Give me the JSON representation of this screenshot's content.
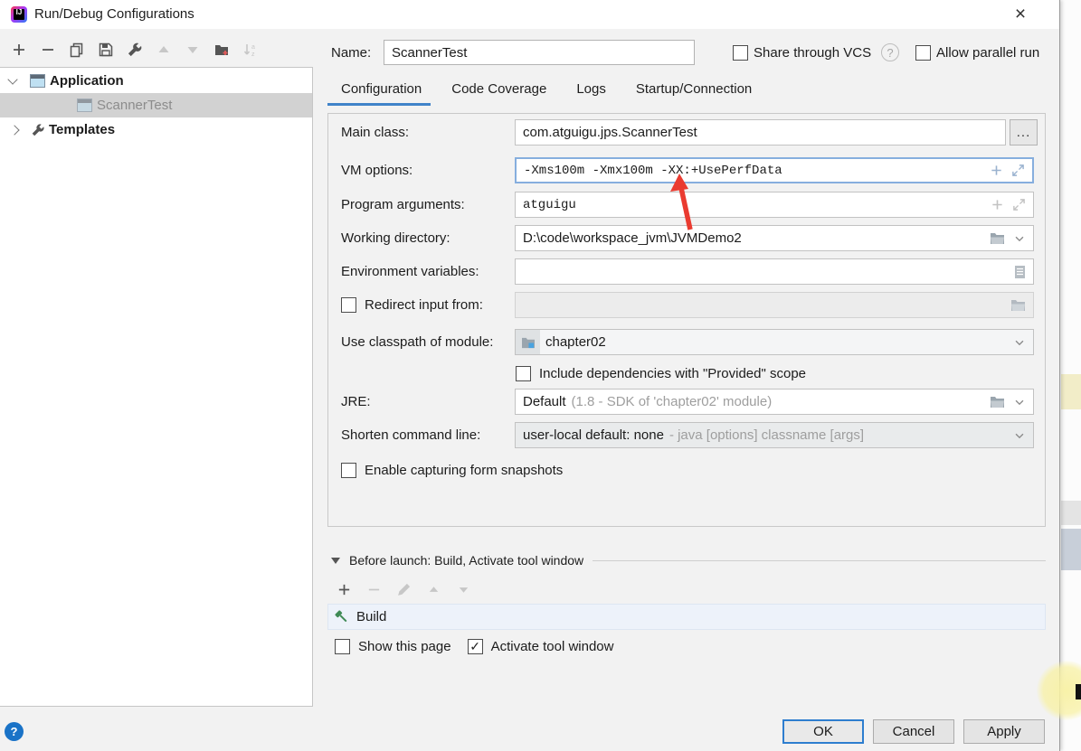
{
  "window": {
    "title": "Run/Debug Configurations",
    "close_glyph": "×",
    "logo_text": "IJ"
  },
  "sidebar": {
    "tree": [
      {
        "label": "Application"
      },
      {
        "label": "ScannerTest"
      },
      {
        "label": "Templates"
      }
    ]
  },
  "header": {
    "name_label": "Name:",
    "name_value": "ScannerTest",
    "share_vcs": "Share through VCS",
    "help_glyph": "?",
    "allow_parallel": "Allow parallel run"
  },
  "tabs": [
    {
      "label": "Configuration"
    },
    {
      "label": "Code Coverage"
    },
    {
      "label": "Logs"
    },
    {
      "label": "Startup/Connection"
    }
  ],
  "form": {
    "main_class": {
      "label": "Main class:",
      "value": "com.atguigu.jps.ScannerTest",
      "browse": "..."
    },
    "vm_options": {
      "label": "VM options:",
      "value": "-Xms100m -Xmx100m -XX:+UsePerfData"
    },
    "program_arguments": {
      "label": "Program arguments:",
      "value": "atguigu"
    },
    "working_directory": {
      "label": "Working directory:",
      "value": "D:\\code\\workspace_jvm\\JVMDemo2"
    },
    "environment_variables": {
      "label": "Environment variables:",
      "value": ""
    },
    "redirect_input": {
      "label": "Redirect input from:",
      "value": ""
    },
    "use_classpath": {
      "label": "Use classpath of module:",
      "value": "chapter02"
    },
    "include_provided": {
      "label": "Include dependencies with \"Provided\" scope"
    },
    "jre": {
      "label": "JRE:",
      "value": "Default",
      "hint": "(1.8 - SDK of 'chapter02' module)"
    },
    "shorten_command_line": {
      "label": "Shorten command line:",
      "value": "user-local default: none",
      "hint": "- java [options] classname [args]"
    },
    "enable_capturing": {
      "label": "Enable capturing form snapshots"
    }
  },
  "before_launch": {
    "title": "Before launch: Build, Activate tool window",
    "tasks": [
      {
        "label": "Build"
      }
    ],
    "show_this_page": "Show this page",
    "activate_tool_window": "Activate tool window",
    "check_glyph": "✓"
  },
  "footer": {
    "ok": "OK",
    "cancel": "Cancel",
    "apply": "Apply",
    "help_glyph": "?"
  },
  "colors": {
    "accent": "#3c7fc2",
    "tab_underline": "#4083c9",
    "selection_bg": "#d2d2d2",
    "focus_border": "#86aede",
    "build_row_bg": "#edf2fa",
    "hammer_green": "#3f8a55",
    "arrow_red": "#ea3b30",
    "help_blue": "#1a73c7",
    "highlight_yellow": "#f8f1a4"
  }
}
